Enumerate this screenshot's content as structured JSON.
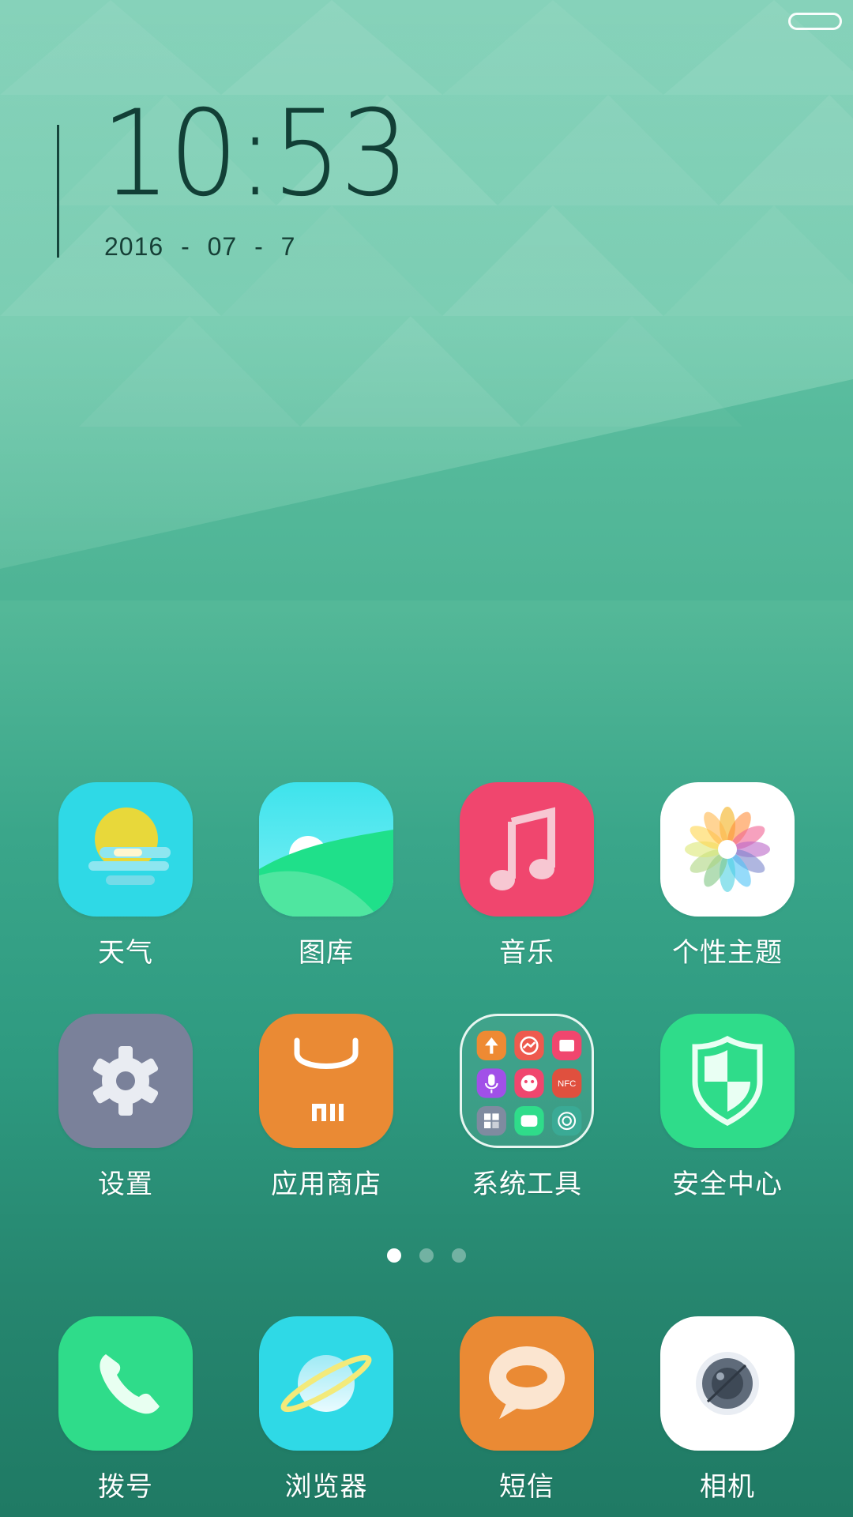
{
  "clock": {
    "time": "10:53",
    "date": "2016 - 07 - 7"
  },
  "colors": {
    "weather_bg": "#2fd9e6",
    "gallery_bg": "#2fd0e6",
    "music_bg": "#f0466e",
    "theme_bg": "#ffffff",
    "settings_bg": "#7a819a",
    "store_bg": "#ea8a34",
    "tools_border": "#e8f6f1",
    "security_bg": "#2fdc8a",
    "dialer_bg": "#2fdc8a",
    "browser_bg": "#2fd9e6",
    "sms_bg": "#ea8a34",
    "camera_bg": "#ffffff"
  },
  "apps_row1": [
    {
      "label": "天气",
      "icon": "weather-icon"
    },
    {
      "label": "图库",
      "icon": "gallery-icon"
    },
    {
      "label": "音乐",
      "icon": "music-icon"
    },
    {
      "label": "个性主题",
      "icon": "theme-icon"
    }
  ],
  "apps_row2": [
    {
      "label": "设置",
      "icon": "settings-icon"
    },
    {
      "label": "应用商店",
      "icon": "app-store-icon"
    },
    {
      "label": "系统工具",
      "icon": "system-tools-folder-icon",
      "folder_nfc_label": "NFC"
    },
    {
      "label": "安全中心",
      "icon": "security-center-icon"
    }
  ],
  "page_indicator": {
    "pages": 3,
    "active": 1
  },
  "dock": [
    {
      "label": "拨号",
      "icon": "phone-icon"
    },
    {
      "label": "浏览器",
      "icon": "browser-icon"
    },
    {
      "label": "短信",
      "icon": "sms-icon"
    },
    {
      "label": "相机",
      "icon": "camera-icon"
    }
  ]
}
